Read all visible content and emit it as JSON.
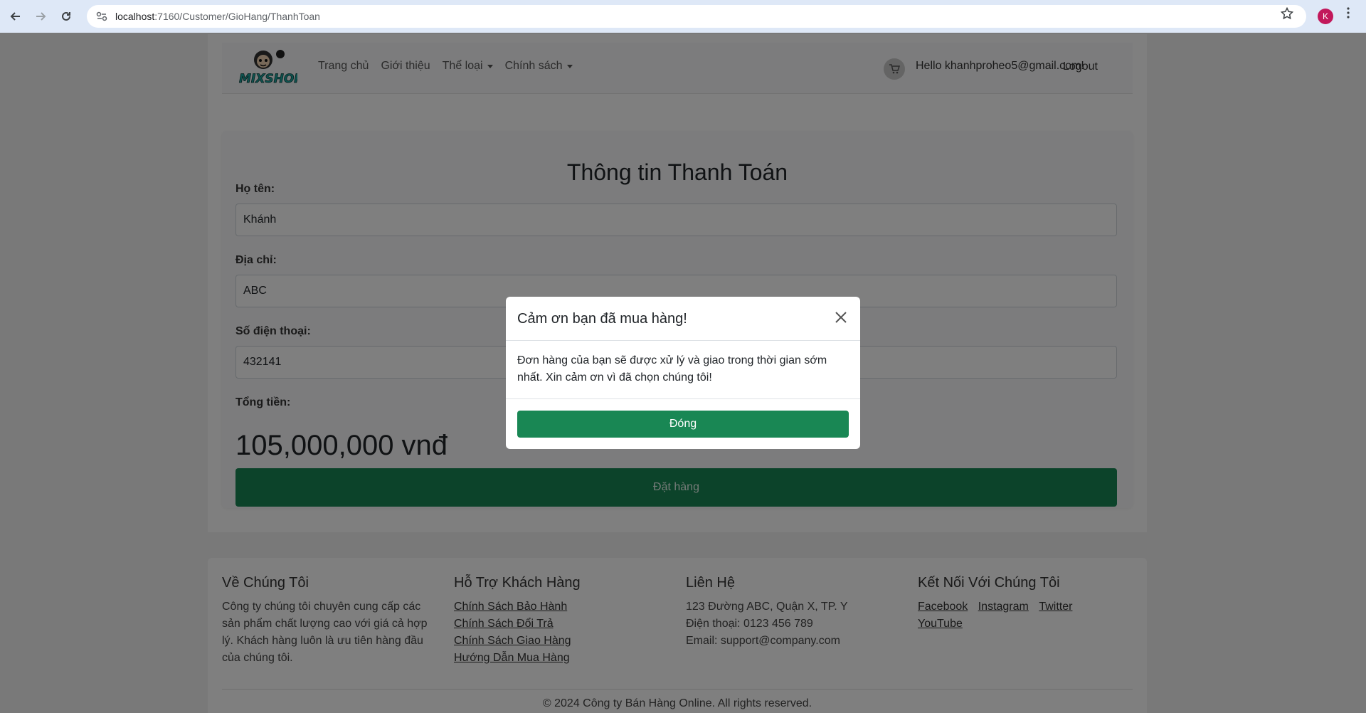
{
  "browser": {
    "url_host": "localhost",
    "url_path": ":7160/Customer/GioHang/ThanhToan",
    "profile_initial": "K",
    "profile_color": "#c2185b"
  },
  "navbar": {
    "logo_alt": "MIXSHOP",
    "links": [
      {
        "label": "Trang chủ",
        "dropdown": false
      },
      {
        "label": "Giới thiệu",
        "dropdown": false
      },
      {
        "label": "Thể loại",
        "dropdown": true
      },
      {
        "label": "Chính sách",
        "dropdown": true
      }
    ],
    "greeting": "Hello khanhproheo5@gmail.com!",
    "logout": "Logout"
  },
  "checkout": {
    "title": "Thông tin Thanh Toán",
    "name_label": "Họ tên:",
    "name_value": "Khánh",
    "address_label": "Địa chỉ:",
    "address_value": "ABC",
    "phone_label": "Số điện thoại:",
    "phone_value": "432141",
    "total_label": "Tổng tiền:",
    "total_value": "105,000,000 vnđ",
    "order_button": "Đặt hàng"
  },
  "footer": {
    "about_title": "Về Chúng Tôi",
    "about_text": "Công ty chúng tôi chuyên cung cấp các sản phẩm chất lượng cao với giá cả hợp lý. Khách hàng luôn là ưu tiên hàng đầu của chúng tôi.",
    "support_title": "Hỗ Trợ Khách Hàng",
    "support_links": [
      "Chính Sách Bảo Hành",
      "Chính Sách Đổi Trả",
      "Chính Sách Giao Hàng",
      "Hướng Dẫn Mua Hàng"
    ],
    "contact_title": "Liên Hệ",
    "contact_address": "123 Đường ABC, Quận X, TP. Y",
    "contact_phone": "Điện thoại: 0123 456 789",
    "contact_email": "Email: support@company.com",
    "social_title": "Kết Nối Với Chúng Tôi",
    "social_links": [
      "Facebook",
      "Instagram",
      "Twitter",
      "YouTube"
    ],
    "copyright": "© 2024 Công ty Bán Hàng Online. All rights reserved."
  },
  "modal": {
    "title": "Cảm ơn bạn đã mua hàng!",
    "body": "Đơn hàng của bạn sẽ được xử lý và giao trong thời gian sớm nhất. Xin cảm ơn vì đã chọn chúng tôi!",
    "close_button": "Đóng"
  },
  "colors": {
    "primary_green": "#198754"
  }
}
